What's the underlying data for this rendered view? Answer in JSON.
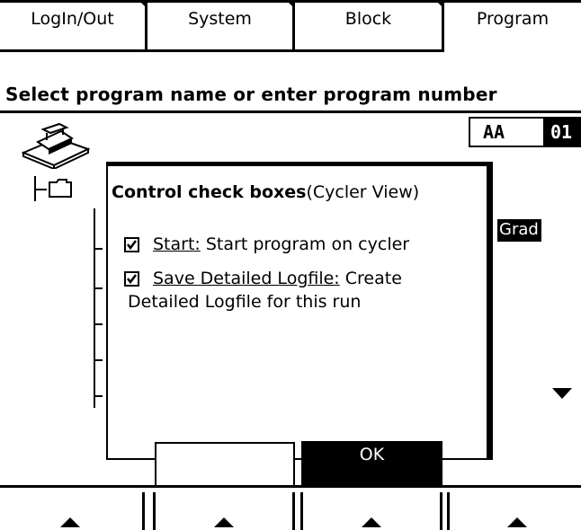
{
  "tabs": [
    {
      "label": "LogIn/Out"
    },
    {
      "label": "System"
    },
    {
      "label": "Block"
    },
    {
      "label": "Program"
    }
  ],
  "prompt": "Select program name or enter program number",
  "program_id": {
    "prefix": "AA",
    "number": "01"
  },
  "grad_label": "Grad",
  "dialog": {
    "title_bold": "Control check boxes",
    "title_rest": "(Cycler View)",
    "options": [
      {
        "name": "Start:",
        "desc": "Start program on cycler",
        "checked": true
      },
      {
        "name": "Save Detailed Logfile:",
        "desc": "Create",
        "desc_line2": "Detailed Logfile for this run",
        "checked": true
      }
    ],
    "ok_label": "OK",
    "other_button_label": ""
  },
  "icons": {
    "cycler": "cycler-device-icon",
    "folder": "folder-icon",
    "checkbox": "checkbox-checked-icon",
    "scroll_down": "down-arrow-icon",
    "softkey": "up-arrow-icon"
  }
}
